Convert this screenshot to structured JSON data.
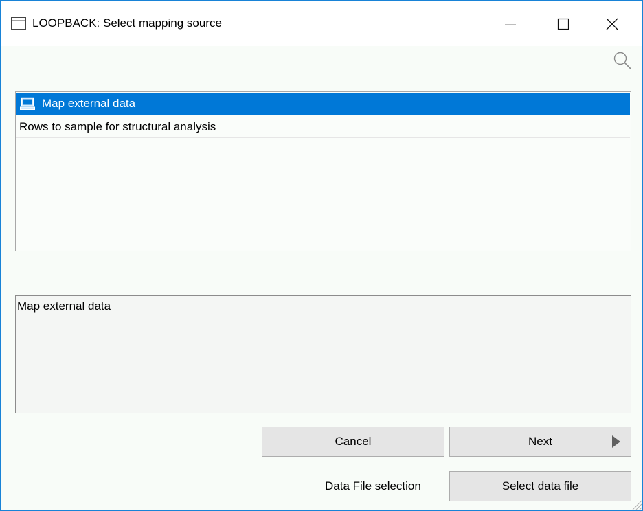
{
  "window": {
    "title": "LOOPBACK: Select mapping source",
    "icons": {
      "app": "window-list-icon",
      "minimize": "minimize-icon",
      "maximize": "maximize-icon",
      "close": "close-icon",
      "search": "search-icon"
    }
  },
  "list": {
    "items": [
      {
        "label": "Map external data",
        "selected": true,
        "icon": "computer-icon"
      },
      {
        "label": "Rows to sample for structural analysis",
        "selected": false
      }
    ]
  },
  "description": {
    "text": "Map external data"
  },
  "buttons": {
    "cancel": "Cancel",
    "next": "Next",
    "select_file": "Select data file"
  },
  "file_selection": {
    "label": "Data File selection"
  },
  "colors": {
    "selection": "#0078d7",
    "button_bg": "#e5e5e5",
    "window_border": "#1883d7"
  }
}
